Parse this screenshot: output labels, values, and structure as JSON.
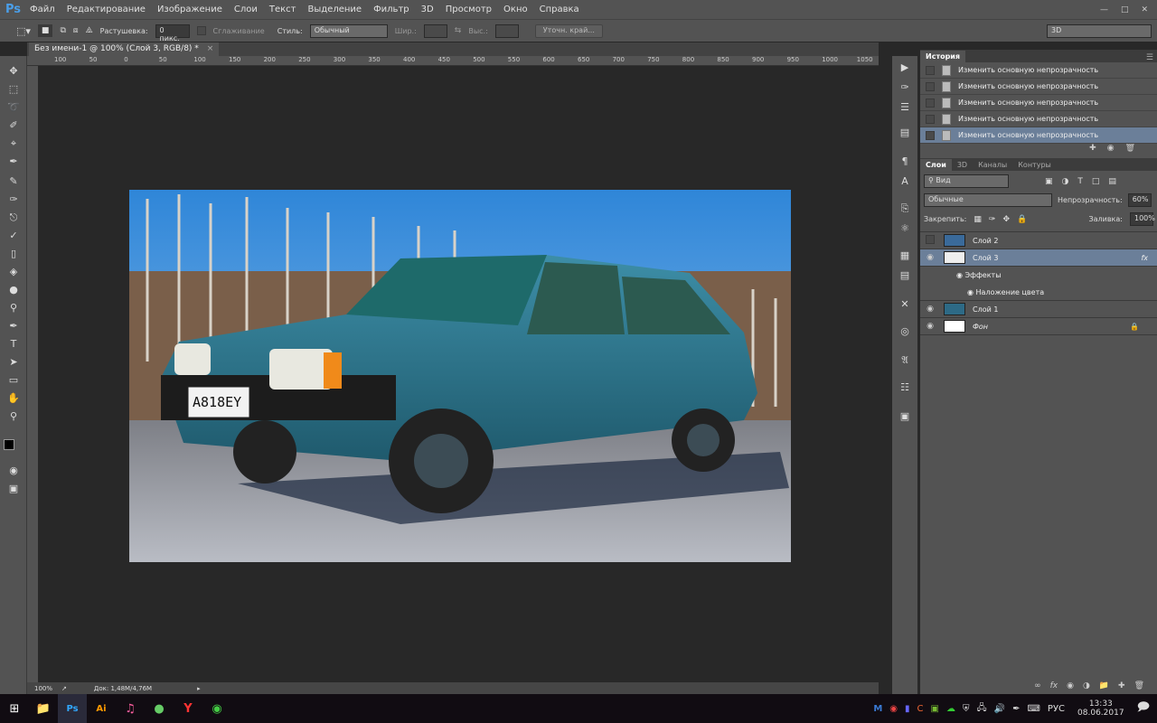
{
  "app": {
    "logo": "Ps"
  },
  "menu": [
    "Файл",
    "Редактирование",
    "Изображение",
    "Слои",
    "Текст",
    "Выделение",
    "Фильтр",
    "3D",
    "Просмотр",
    "Окно",
    "Справка"
  ],
  "options": {
    "feather_label": "Растушевка:",
    "feather_value": "0 пикс.",
    "antialias_label": "Сглаживание",
    "style_label": "Стиль:",
    "style_value": "Обычный",
    "width_label": "Шир.:",
    "height_label": "Выс.:",
    "refine_button": "Уточн. край...",
    "workspace": "3D"
  },
  "document": {
    "tab_title": "Без имени-1 @ 100% (Слой 3, RGB/8) *",
    "close": "×",
    "zoom": "100%",
    "doc_size": "Док: 1,48M/4,76M"
  },
  "ruler_ticks": [
    "100",
    "50",
    "0",
    "50",
    "100",
    "150",
    "200",
    "250",
    "300",
    "350",
    "400",
    "450",
    "500",
    "550",
    "600",
    "650",
    "700",
    "750",
    "800",
    "850",
    "900",
    "950",
    "1000",
    "1050"
  ],
  "history": {
    "title": "История",
    "items": [
      "Изменить основную непрозрачность",
      "Изменить основную непрозрачность",
      "Изменить основную непрозрачность",
      "Изменить основную непрозрачность",
      "Изменить основную непрозрачность"
    ]
  },
  "layers_panel": {
    "tabs": [
      "Слои",
      "3D",
      "Каналы",
      "Контуры"
    ],
    "filter": "Вид",
    "blend_mode": "Обычные",
    "opacity_label": "Непрозрачность:",
    "opacity": "60%",
    "lock_label": "Закрепить:",
    "fill_label": "Заливка:",
    "fill": "100%",
    "layers": [
      {
        "name": "Слой 2",
        "visible": false
      },
      {
        "name": "Слой 3",
        "visible": true,
        "selected": true,
        "fx": "fx"
      },
      {
        "name": "Эффекты",
        "sub": true
      },
      {
        "name": "Наложение цвета",
        "sub": true
      },
      {
        "name": "Слой 1",
        "visible": true
      },
      {
        "name": "Фон",
        "visible": true,
        "locked": true
      }
    ]
  },
  "taskbar": {
    "lang": "РУС",
    "time": "13:33",
    "date": "08.06.2017"
  },
  "colors": {
    "accent": "#6b7f99",
    "panel": "#535353",
    "canvas": "#282828"
  }
}
